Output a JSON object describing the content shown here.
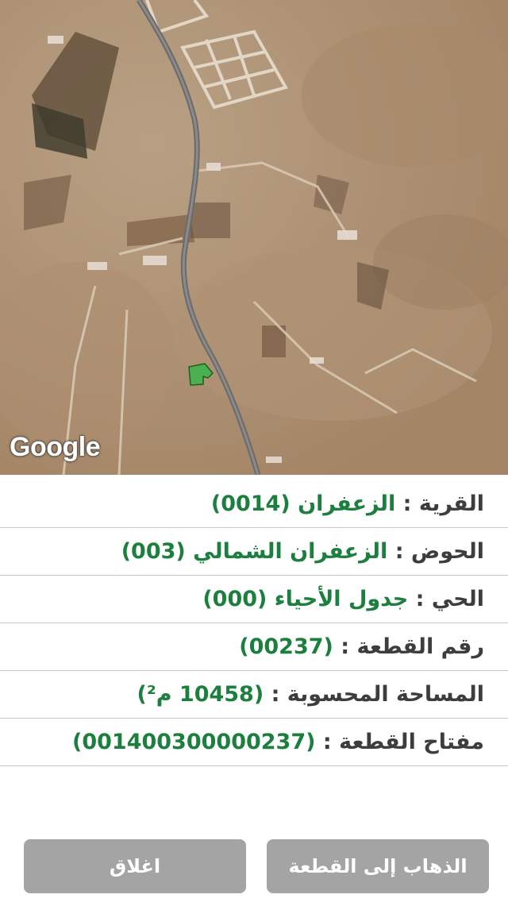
{
  "map": {
    "attribution": "Google"
  },
  "parcel_info": {
    "village": {
      "label": "القرية :",
      "value": "الزعفران (0014)"
    },
    "basin": {
      "label": "الحوض :",
      "value": "الزعفران الشمالي (003)"
    },
    "neighborhood": {
      "label": "الحي :",
      "value": "جدول الأحياء (000)"
    },
    "parcel_number": {
      "label": "رقم القطعة :",
      "value": "(00237)"
    },
    "area": {
      "label": "المساحة المحسوبة :",
      "value": "(10458 م²)"
    },
    "parcel_key": {
      "label": "مفتاح القطعة :",
      "value": "(001400300000237)"
    }
  },
  "actions": {
    "go_to_parcel": "الذهاب إلى القطعة",
    "close": "اغلاق"
  },
  "colors": {
    "value_text": "#1b7f3e",
    "button_bg": "#a4a4a4",
    "parcel_fill": "#4caf50"
  }
}
